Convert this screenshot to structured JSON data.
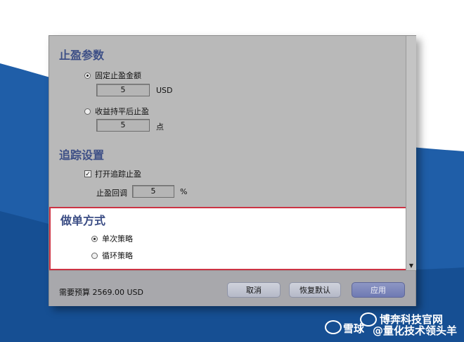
{
  "stop_profit": {
    "title": "止盈参数",
    "fixed_amount_label": "固定止盈金额",
    "fixed_amount_value": "5",
    "fixed_amount_unit": "USD",
    "fixed_amount_selected": true,
    "hold_label": "收益持平后止盈",
    "hold_value": "5",
    "hold_unit": "点",
    "hold_selected": false
  },
  "trailing": {
    "title": "追踪设置",
    "enable_label": "打开追踪止盈",
    "enable_checked": true,
    "pullback_label": "止盈回调",
    "pullback_value": "5",
    "pullback_unit": "%"
  },
  "order_mode": {
    "title": "做单方式",
    "options": [
      {
        "label": "单次策略",
        "selected": true
      },
      {
        "label": "循环策略",
        "selected": false
      }
    ]
  },
  "footer": {
    "budget_label": "需要预算",
    "budget_value": "2569.00",
    "budget_unit": "USD",
    "cancel_label": "取消",
    "reset_label": "恢复默认",
    "apply_label": "应用"
  },
  "watermark": {
    "line1": "博奔科技官网",
    "line2": "雪球",
    "line3": "@量化技术领头羊"
  },
  "colors": {
    "section_title": "#3d4f86",
    "highlight_border": "#cc3344",
    "slide_blue": "#1f5ea8",
    "primary_button": "#7580b8"
  }
}
